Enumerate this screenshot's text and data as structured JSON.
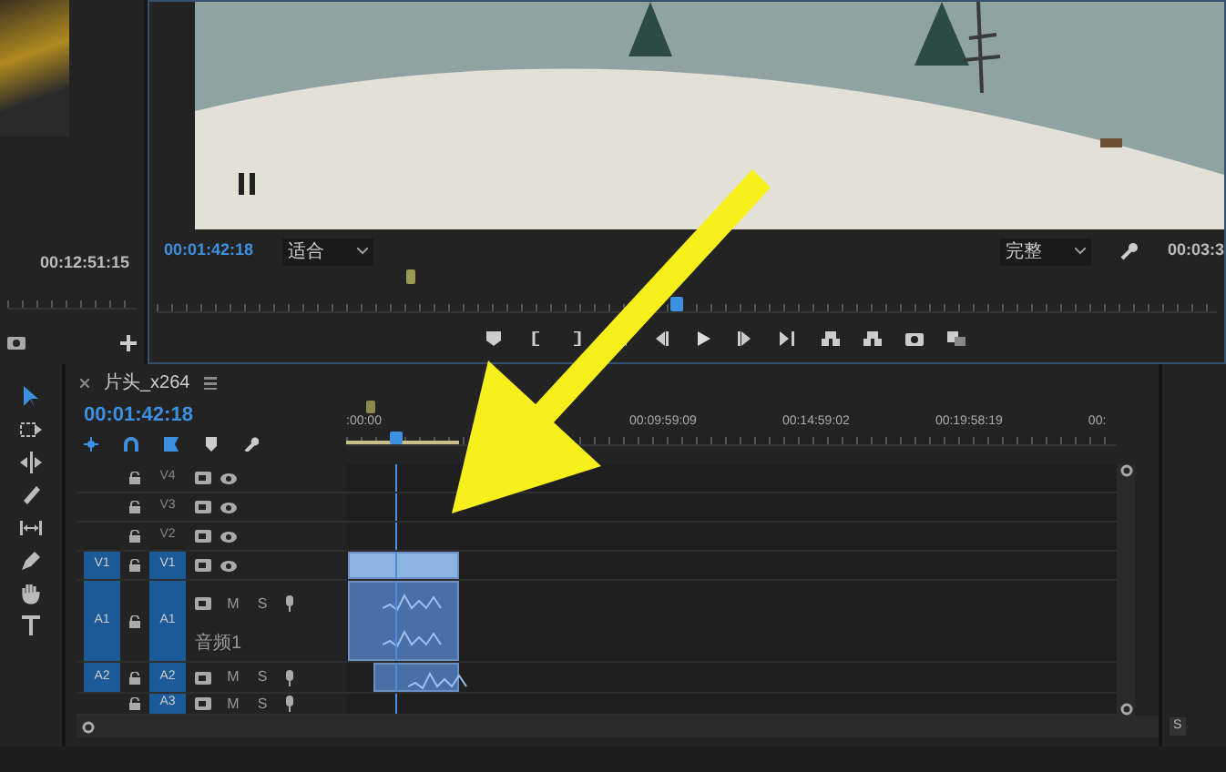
{
  "source_monitor": {
    "timecode": "00:12:51:15"
  },
  "program_monitor": {
    "timecode": "00:01:42:18",
    "fit": "适合",
    "quality": "完整",
    "duration": "00:03:3"
  },
  "timeline": {
    "tab": "片头_x264",
    "timecode": "00:01:42:18",
    "ruler_labels": [
      ":00:00",
      "00:09:59:09",
      "00:14:59:02",
      "00:19:58:19",
      "00:"
    ],
    "tracks": [
      {
        "kind": "video",
        "target": "V4",
        "targeted": false,
        "clip": false
      },
      {
        "kind": "video",
        "target": "V3",
        "targeted": false,
        "clip": false
      },
      {
        "kind": "video",
        "target": "V2",
        "targeted": false,
        "clip": false
      },
      {
        "kind": "video",
        "source": "V1",
        "target": "V1",
        "targeted": true,
        "clip": true
      },
      {
        "kind": "audio",
        "source": "A1",
        "target": "A1",
        "targeted": true,
        "name": "音频1",
        "buttons": [
          "M",
          "S"
        ],
        "clip": true,
        "expanded": true
      },
      {
        "kind": "audio",
        "source": "A2",
        "target": "A2",
        "targeted": true,
        "buttons": [
          "M",
          "S"
        ],
        "clip": true,
        "expanded": false
      },
      {
        "kind": "audio",
        "target": "A3",
        "targeted": true,
        "buttons": [
          "M",
          "S"
        ],
        "clip": false,
        "expanded": false
      }
    ]
  },
  "meter_panel": {
    "buttons": [
      "S"
    ]
  }
}
